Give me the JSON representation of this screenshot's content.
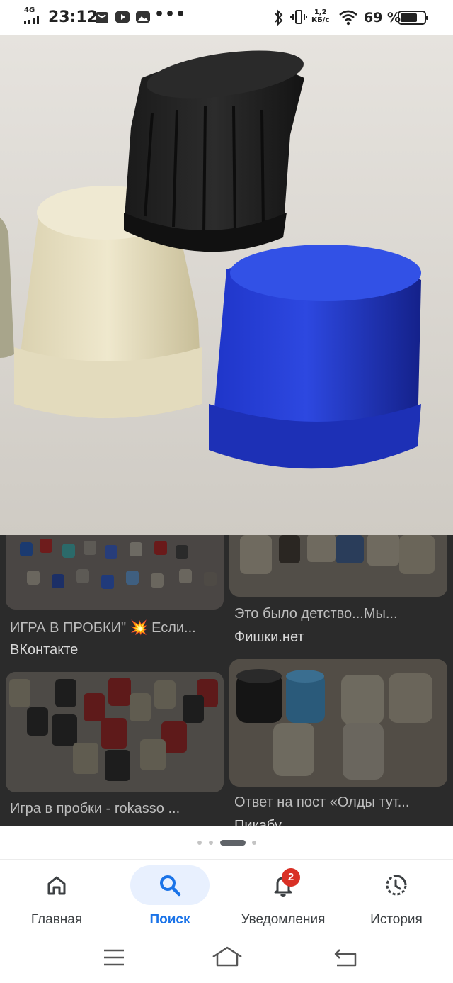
{
  "status_bar": {
    "network": "4G",
    "time": "23:12",
    "more": "•••",
    "speed_value": "1,2",
    "speed_unit": "КБ/с",
    "battery_percent": "69 %"
  },
  "results": [
    {
      "title": "ИГРА В ПРОБКИ\" 💥 Если...",
      "source": "ВКонтакте"
    },
    {
      "title": "Это было детство...Мы...",
      "source": "Фишки.нет"
    },
    {
      "title": "Игра в пробки - rokasso ...",
      "source": ""
    },
    {
      "title": "Ответ на пост «Олды тут...",
      "source": "Пикабу"
    }
  ],
  "pager": {
    "count": 4,
    "active": 2
  },
  "bottom_nav": {
    "items": [
      {
        "label": "Главная",
        "icon": "home-icon"
      },
      {
        "label": "Поиск",
        "icon": "search-icon"
      },
      {
        "label": "Уведомления",
        "icon": "bell-icon",
        "badge": "2"
      },
      {
        "label": "История",
        "icon": "history-icon"
      }
    ],
    "active_index": 1
  },
  "colors": {
    "accent": "#1a73e8",
    "active_pill": "#e8f0fe",
    "badge": "#d93025",
    "overlay": "#2b2b2b"
  }
}
